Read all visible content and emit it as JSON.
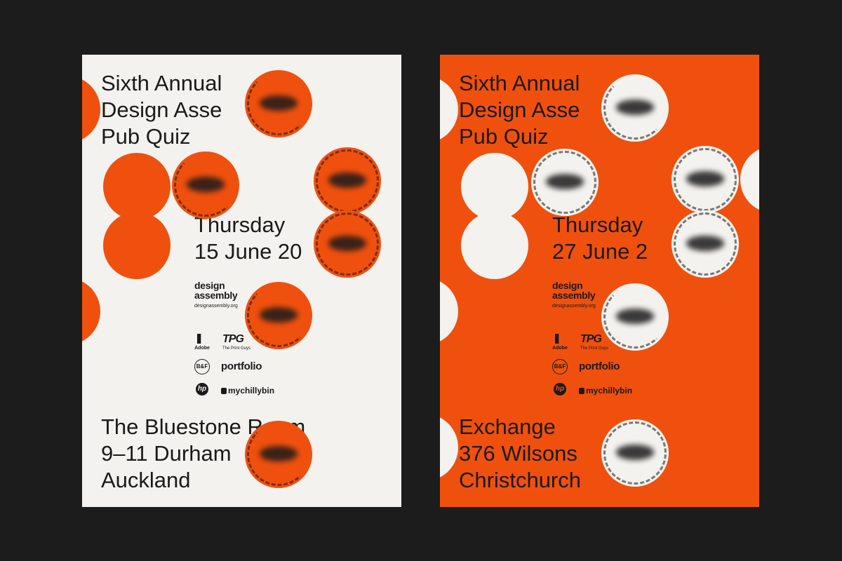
{
  "colors": {
    "background": "#1c1c1c",
    "orange": "#f0500e",
    "paper": "#f4f2ee",
    "ink": "#1a1a1a"
  },
  "posters": [
    {
      "title_lines": [
        "Sixth Annual",
        "Design Asse",
        "Pub Quiz"
      ],
      "date_lines": [
        "Thursday",
        "15 June 20"
      ],
      "brand": {
        "line1": "design",
        "line2": "assembly",
        "url": "designassembly.org"
      },
      "sponsors": {
        "adobe": "Adobe",
        "tpg": "TPG",
        "tpg_sub": "The Print Guys",
        "bf": "B&F",
        "portfolio": "portfolio",
        "hp": "hp",
        "mychillybin": "mychillybin"
      },
      "venue_lines": [
        "The Bluestone Room",
        "9–11 Durham",
        "Auckland"
      ]
    },
    {
      "title_lines": [
        "Sixth Annual",
        "Design Asse",
        "Pub Quiz"
      ],
      "date_lines": [
        "Thursday",
        "27 June 2"
      ],
      "brand": {
        "line1": "design",
        "line2": "assembly",
        "url": "designassembly.org"
      },
      "sponsors": {
        "adobe": "Adobe",
        "tpg": "TPG",
        "tpg_sub": "The Print Guys",
        "bf": "B&F",
        "portfolio": "portfolio",
        "hp": "hp",
        "mychillybin": "mychillybin"
      },
      "venue_lines": [
        "Exchange",
        "376 Wilsons",
        "Christchurch"
      ]
    }
  ]
}
